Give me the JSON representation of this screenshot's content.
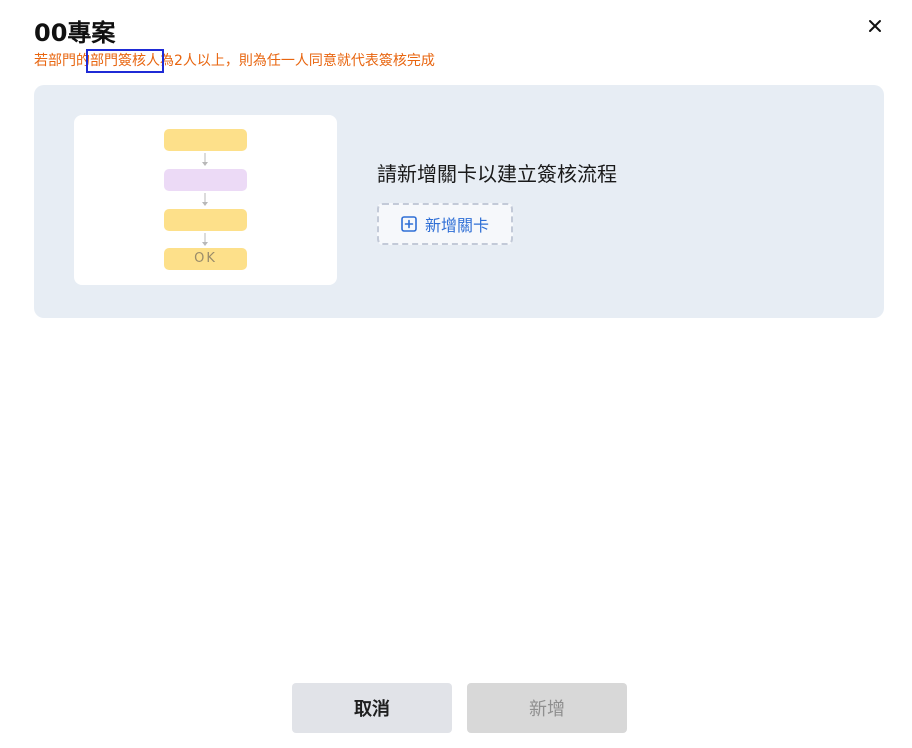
{
  "dialog": {
    "title": "00專案",
    "notice": {
      "prefix": "若部門的",
      "highlight": "部門簽核人",
      "suffix": "為2人以上，則為任一人同意就代表簽核完成"
    },
    "close_icon": "close-icon"
  },
  "flow_preview": {
    "ok_label": "OK",
    "colors": {
      "step_primary": "#fde08a",
      "step_secondary": "#ecdaf6"
    }
  },
  "empty_state": {
    "prompt": "請新增關卡以建立簽核流程",
    "add_stage_label": "新增關卡",
    "add_stage_icon": "plus-square-icon"
  },
  "footer": {
    "cancel_label": "取消",
    "submit_label": "新增"
  },
  "colors": {
    "accent": "#2f6fd6",
    "warning_text": "#e8650f",
    "panel_background": "#e7edf4"
  }
}
